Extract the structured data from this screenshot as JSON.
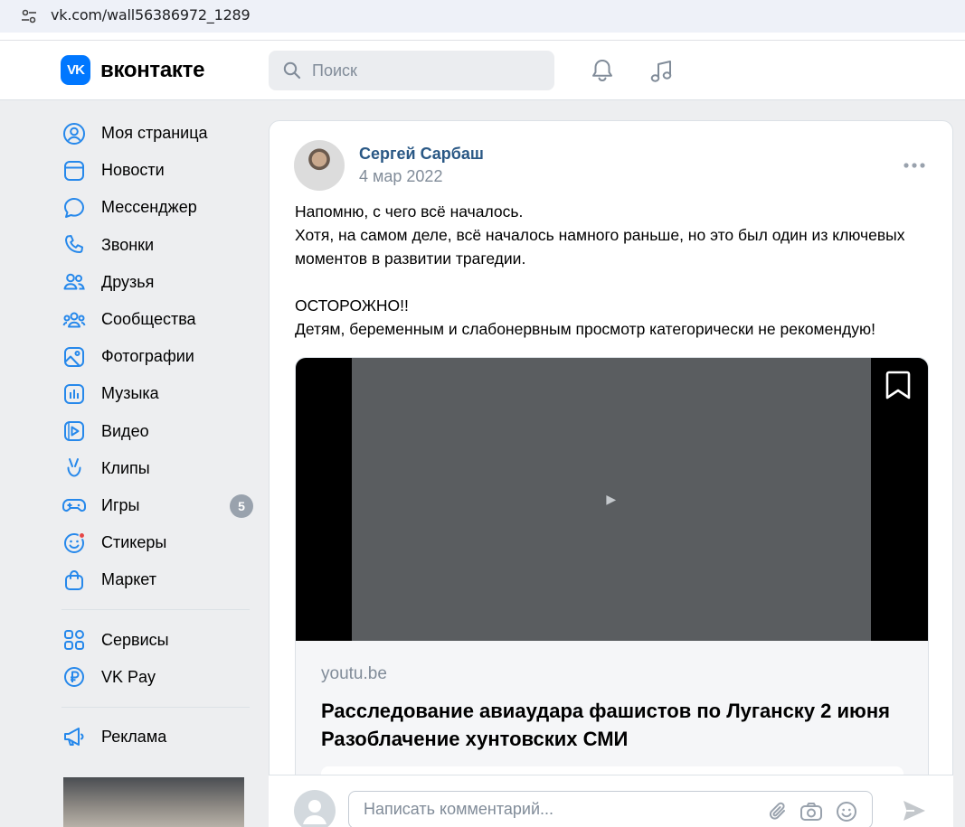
{
  "browser": {
    "url": "vk.com/wall56386972_1289"
  },
  "header": {
    "logo_mark": "VK",
    "logo_text": "вконтакте",
    "search_placeholder": "Поиск",
    "icons": [
      "bell-icon",
      "music-note-icon"
    ]
  },
  "sidebar": {
    "items": [
      {
        "label": "Моя страница",
        "icon": "user-circle-icon"
      },
      {
        "label": "Новости",
        "icon": "news-icon"
      },
      {
        "label": "Мессенджер",
        "icon": "chat-bubble-icon"
      },
      {
        "label": "Звонки",
        "icon": "phone-icon"
      },
      {
        "label": "Друзья",
        "icon": "friends-icon"
      },
      {
        "label": "Сообщества",
        "icon": "communities-icon"
      },
      {
        "label": "Фотографии",
        "icon": "photo-icon"
      },
      {
        "label": "Музыка",
        "icon": "music-icon"
      },
      {
        "label": "Видео",
        "icon": "video-icon"
      },
      {
        "label": "Клипы",
        "icon": "clips-icon"
      },
      {
        "label": "Игры",
        "icon": "gamepad-icon",
        "badge": "5"
      },
      {
        "label": "Стикеры",
        "icon": "sticker-icon"
      },
      {
        "label": "Маркет",
        "icon": "shopping-bag-icon"
      }
    ],
    "secondary": [
      {
        "label": "Сервисы",
        "icon": "services-icon"
      },
      {
        "label": "VK Pay",
        "icon": "ruble-icon"
      }
    ],
    "tertiary": [
      {
        "label": "Реклама",
        "icon": "megaphone-icon"
      }
    ]
  },
  "post": {
    "author": "Сергей Сарбаш",
    "date": "4 мар 2022",
    "text_line1": "Напомню, с чего всё началось.",
    "text_line2": "Хотя, на самом деле, всё началось намного раньше, но это был один из ключевых моментов в развитии трагедии.",
    "text_line3": "ОСТОРОЖНО!!",
    "text_line4": "Детям, беременным и слабонервным просмотр категорически не рекомендую!",
    "attachment": {
      "domain": "youtu.be",
      "title": "Расследование авиаудара фашистов по Луганску 2 июня Разоблачение хунтовских СМИ"
    }
  },
  "comment": {
    "placeholder": "Написать комментарий..."
  },
  "colors": {
    "accent": "#0077ff",
    "link": "#2a5885",
    "muted": "#818c99",
    "bg": "#edeef0"
  }
}
